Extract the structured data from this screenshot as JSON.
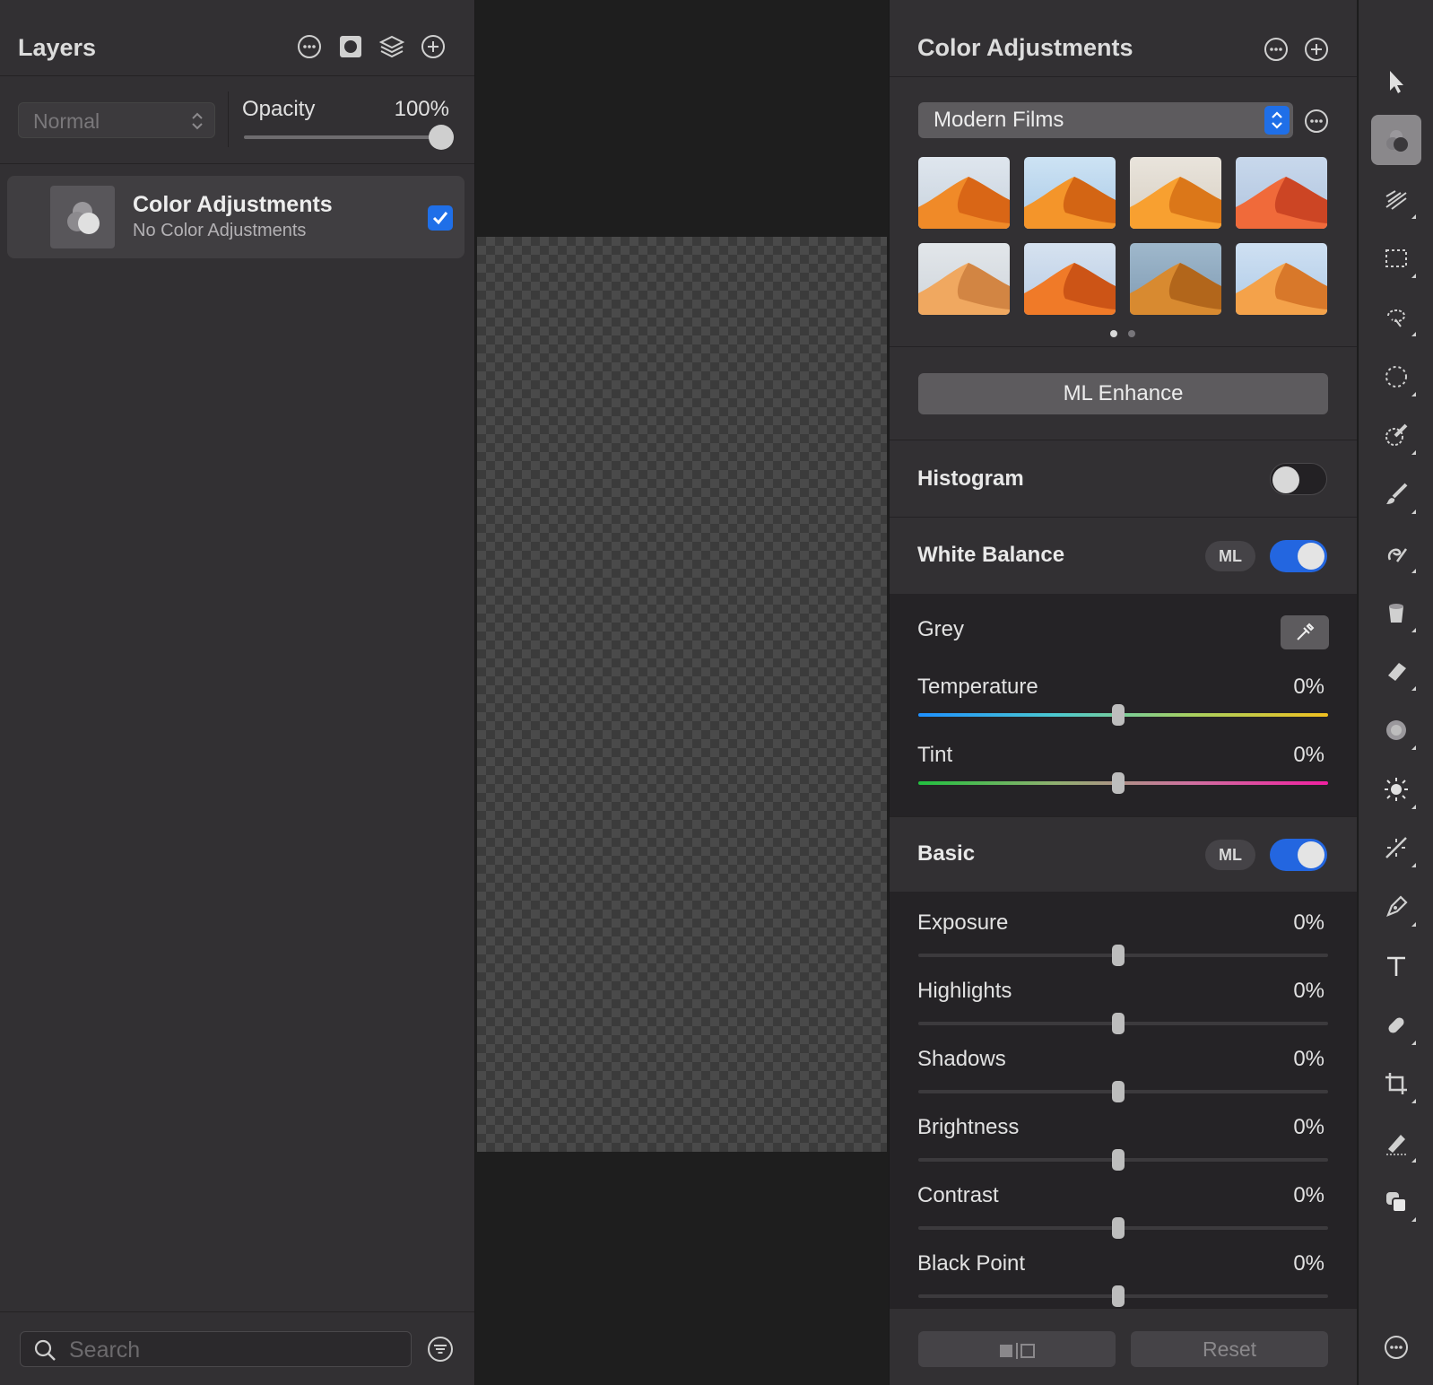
{
  "layers_panel": {
    "title": "Layers",
    "blend_mode": "Normal",
    "opacity_label": "Opacity",
    "opacity_value": "100%",
    "opacity_fraction": 1.0,
    "layer": {
      "name": "Color Adjustments",
      "subtitle": "No Color Adjustments",
      "visible": true
    },
    "search_placeholder": "Search"
  },
  "adjust_panel": {
    "title": "Color Adjustments",
    "preset": "Modern Films",
    "preset_thumbnail_count": 8,
    "preset_page": 1,
    "preset_pages": 2,
    "ml_enhance_label": "ML Enhance",
    "histogram": {
      "title": "Histogram",
      "enabled": false
    },
    "white_balance": {
      "title": "White Balance",
      "ml_label": "ML",
      "enabled": true,
      "grey_label": "Grey",
      "temperature": {
        "label": "Temperature",
        "value": "0%"
      },
      "tint": {
        "label": "Tint",
        "value": "0%"
      }
    },
    "basic": {
      "title": "Basic",
      "ml_label": "ML",
      "enabled": true,
      "sliders": [
        {
          "label": "Exposure",
          "value": "0%"
        },
        {
          "label": "Highlights",
          "value": "0%"
        },
        {
          "label": "Shadows",
          "value": "0%"
        },
        {
          "label": "Brightness",
          "value": "0%"
        },
        {
          "label": "Contrast",
          "value": "0%"
        },
        {
          "label": "Black Point",
          "value": "0%"
        }
      ]
    },
    "reset_label": "Reset"
  },
  "tools": [
    "arrow-icon",
    "color-adjust-icon",
    "effects-icon",
    "rect-select-icon",
    "lasso-icon",
    "ellipse-select-icon",
    "quick-select-icon",
    "brush-icon",
    "smudge-icon",
    "paint-bucket-icon",
    "eraser-icon",
    "noise-icon",
    "light-icon",
    "retouch-icon",
    "pen-icon",
    "text-icon",
    "bandage-icon",
    "crop-icon",
    "sample-icon",
    "shapes-icon",
    "more-icon"
  ],
  "colors": {
    "accent": "#1f6fe8",
    "panel": "#323033",
    "canvas": "#1e1e1e"
  }
}
